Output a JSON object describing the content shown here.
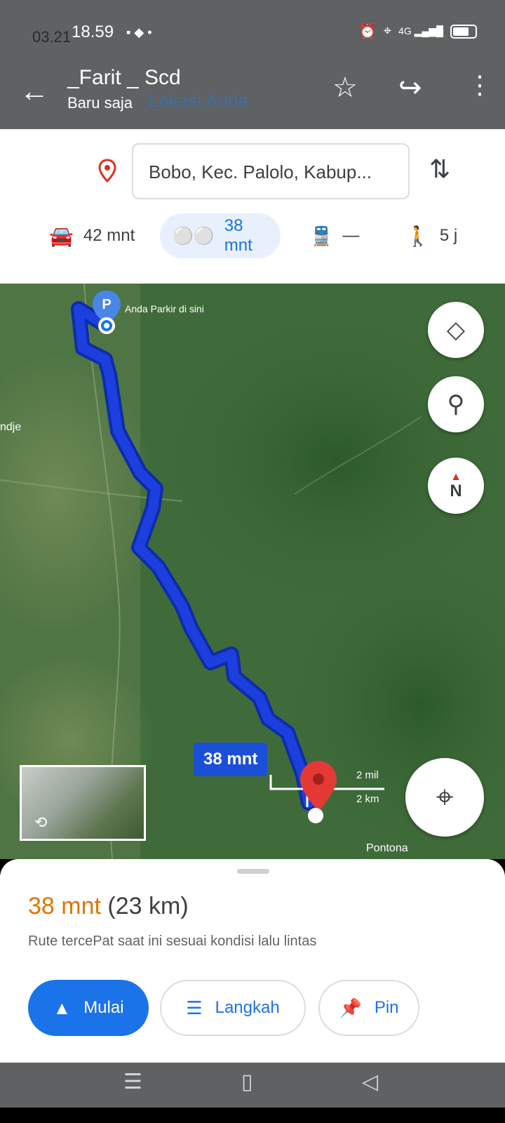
{
  "status": {
    "time": "18.59",
    "under_time": "03.21",
    "network": "4G"
  },
  "notification": {
    "sender": "_Farit _ Scd",
    "subtitle": "Baru saja",
    "behind_origin": "Lokasi Anda"
  },
  "route_form": {
    "destination": "Bobo, Kec. Palolo, Kabup..."
  },
  "modes": [
    {
      "name": "car",
      "label": "42 mnt"
    },
    {
      "name": "motorcycle",
      "label": "38 mnt"
    },
    {
      "name": "transit",
      "label": "—"
    },
    {
      "name": "walk",
      "label": "5 j"
    }
  ],
  "map": {
    "parking_label": "Anda Parkir di sini",
    "place_left": "ndje",
    "place_bottom": "Pontona",
    "route_badge": "38 mnt",
    "scale_mi": "2 mil",
    "scale_km": "2 km",
    "compass": "N"
  },
  "sheet": {
    "duration": "38 mnt",
    "distance": "(23 km)",
    "description": "Rute tercePat saat ini sesuai kondisi lalu lintas",
    "start_label": "Mulai",
    "steps_label": "Langkah",
    "pin_label": "Pin"
  },
  "colors": {
    "accent": "#1a73e8",
    "route": "#1d3fe0",
    "duration": "#e37400"
  }
}
